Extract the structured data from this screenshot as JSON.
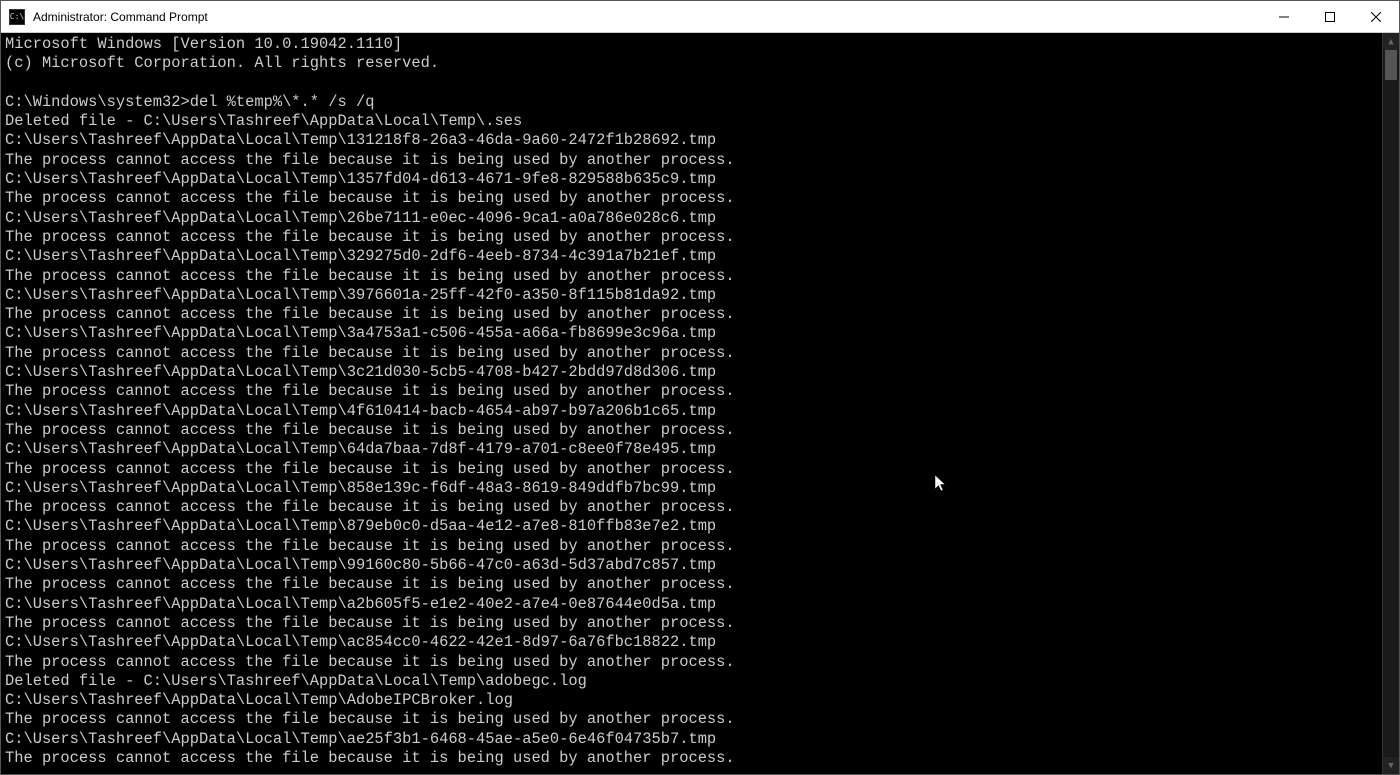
{
  "window": {
    "title": "Administrator: Command Prompt",
    "icon_text": "C:\\"
  },
  "terminal": {
    "header_line1": "Microsoft Windows [Version 10.0.19042.1110]",
    "header_line2": "(c) Microsoft Corporation. All rights reserved.",
    "prompt_path": "C:\\Windows\\system32>",
    "command": "del %temp%\\*.* /s /q",
    "temp_path": "C:\\Users\\Tashreef\\AppData\\Local\\Temp\\",
    "deleted_prefix": "Deleted file - ",
    "error_msg": "The process cannot access the file because it is being used by another process.",
    "lines": [
      "Deleted file - C:\\Users\\Tashreef\\AppData\\Local\\Temp\\.ses",
      "C:\\Users\\Tashreef\\AppData\\Local\\Temp\\131218f8-26a3-46da-9a60-2472f1b28692.tmp",
      "The process cannot access the file because it is being used by another process.",
      "C:\\Users\\Tashreef\\AppData\\Local\\Temp\\1357fd04-d613-4671-9fe8-829588b635c9.tmp",
      "The process cannot access the file because it is being used by another process.",
      "C:\\Users\\Tashreef\\AppData\\Local\\Temp\\26be7111-e0ec-4096-9ca1-a0a786e028c6.tmp",
      "The process cannot access the file because it is being used by another process.",
      "C:\\Users\\Tashreef\\AppData\\Local\\Temp\\329275d0-2df6-4eeb-8734-4c391a7b21ef.tmp",
      "The process cannot access the file because it is being used by another process.",
      "C:\\Users\\Tashreef\\AppData\\Local\\Temp\\3976601a-25ff-42f0-a350-8f115b81da92.tmp",
      "The process cannot access the file because it is being used by another process.",
      "C:\\Users\\Tashreef\\AppData\\Local\\Temp\\3a4753a1-c506-455a-a66a-fb8699e3c96a.tmp",
      "The process cannot access the file because it is being used by another process.",
      "C:\\Users\\Tashreef\\AppData\\Local\\Temp\\3c21d030-5cb5-4708-b427-2bdd97d8d306.tmp",
      "The process cannot access the file because it is being used by another process.",
      "C:\\Users\\Tashreef\\AppData\\Local\\Temp\\4f610414-bacb-4654-ab97-b97a206b1c65.tmp",
      "The process cannot access the file because it is being used by another process.",
      "C:\\Users\\Tashreef\\AppData\\Local\\Temp\\64da7baa-7d8f-4179-a701-c8ee0f78e495.tmp",
      "The process cannot access the file because it is being used by another process.",
      "C:\\Users\\Tashreef\\AppData\\Local\\Temp\\858e139c-f6df-48a3-8619-849ddfb7bc99.tmp",
      "The process cannot access the file because it is being used by another process.",
      "C:\\Users\\Tashreef\\AppData\\Local\\Temp\\879eb0c0-d5aa-4e12-a7e8-810ffb83e7e2.tmp",
      "The process cannot access the file because it is being used by another process.",
      "C:\\Users\\Tashreef\\AppData\\Local\\Temp\\99160c80-5b66-47c0-a63d-5d37abd7c857.tmp",
      "The process cannot access the file because it is being used by another process.",
      "C:\\Users\\Tashreef\\AppData\\Local\\Temp\\a2b605f5-e1e2-40e2-a7e4-0e87644e0d5a.tmp",
      "The process cannot access the file because it is being used by another process.",
      "C:\\Users\\Tashreef\\AppData\\Local\\Temp\\ac854cc0-4622-42e1-8d97-6a76fbc18822.tmp",
      "The process cannot access the file because it is being used by another process.",
      "Deleted file - C:\\Users\\Tashreef\\AppData\\Local\\Temp\\adobegc.log",
      "C:\\Users\\Tashreef\\AppData\\Local\\Temp\\AdobeIPCBroker.log",
      "The process cannot access the file because it is being used by another process.",
      "C:\\Users\\Tashreef\\AppData\\Local\\Temp\\ae25f3b1-6468-45ae-a5e0-6e46f04735b7.tmp",
      "The process cannot access the file because it is being used by another process."
    ]
  }
}
